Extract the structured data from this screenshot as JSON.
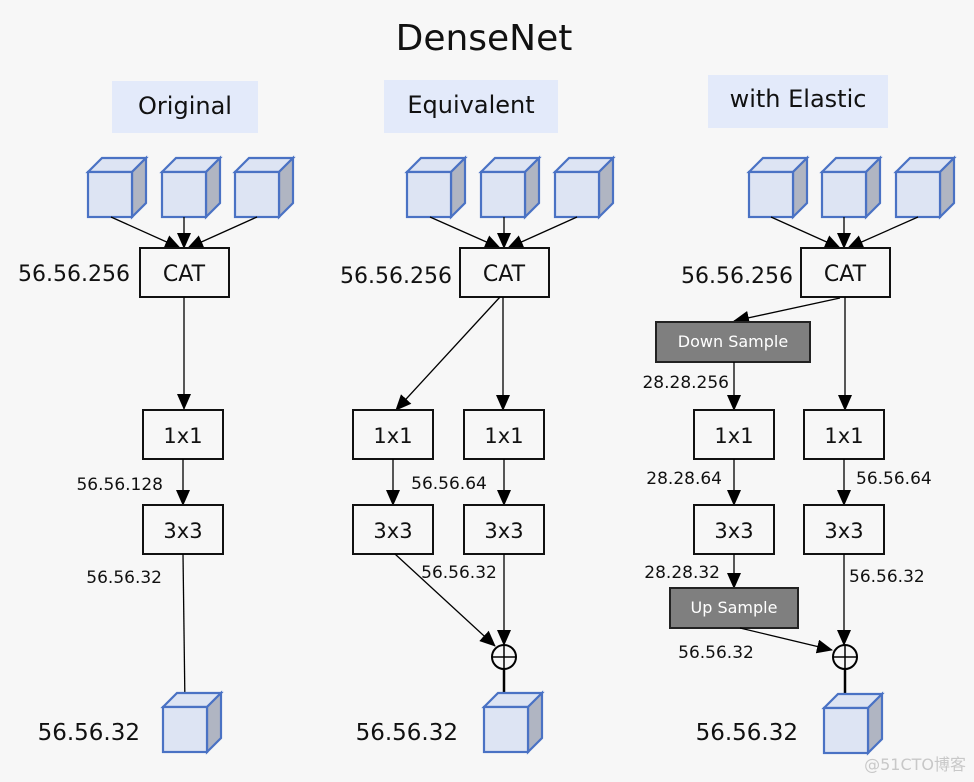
{
  "title": "DenseNet",
  "colors": {
    "background": "#f7f7f7",
    "header_fill": "#e3eafa",
    "cube_front": "#dde4f3",
    "cube_side": "#b0b5c2",
    "cube_stroke": "#4a72c4",
    "sample_box": "#7f7f7f",
    "sample_text": "#ffffff",
    "line": "#000000"
  },
  "panels": [
    {
      "header": "Original",
      "cat_label": "CAT",
      "cat_dims": "56.56.256",
      "branches": [
        {
          "conv1": "1x1",
          "conv1_out": "56.56.128",
          "conv3": "3x3",
          "conv3_out": "56.56.32"
        }
      ],
      "output_dims": "56.56.32"
    },
    {
      "header": "Equivalent",
      "cat_label": "CAT",
      "cat_dims": "56.56.256",
      "branches": [
        {
          "conv1": "1x1",
          "conv3": "3x3"
        },
        {
          "conv1": "1x1",
          "conv3": "3x3"
        }
      ],
      "shared_conv1_out": "56.56.64",
      "shared_conv3_out": "56.56.32",
      "merge": "add",
      "output_dims": "56.56.32"
    },
    {
      "header": "with Elastic",
      "cat_label": "CAT",
      "cat_dims": "56.56.256",
      "down_sample": {
        "label": "Down Sample",
        "out": "28.28.256"
      },
      "up_sample": {
        "label": "Up Sample",
        "out": "56.56.32"
      },
      "branches": [
        {
          "conv1": "1x1",
          "conv1_out": "28.28.64",
          "conv3": "3x3",
          "conv3_out": "28.28.32"
        },
        {
          "conv1": "1x1",
          "conv1_out": "56.56.64",
          "conv3": "3x3",
          "conv3_out": "56.56.32"
        }
      ],
      "merge": "add",
      "output_dims": "56.56.32"
    }
  ],
  "watermark": "@51CTO博客"
}
